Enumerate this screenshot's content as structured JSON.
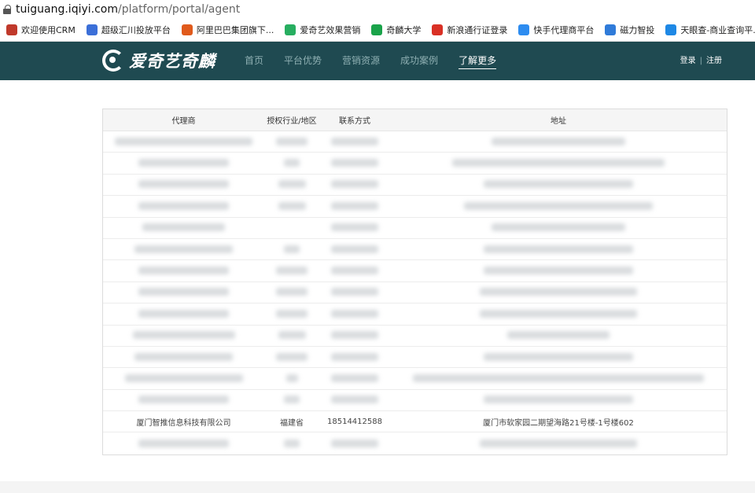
{
  "browser": {
    "url_domain": "tuiguang.iqiyi.com",
    "url_path": "/platform/portal/agent"
  },
  "bookmarks": [
    {
      "label": "欢迎使用CRM",
      "icon": "crm-icon",
      "color": "#c0392b"
    },
    {
      "label": "超级汇川投放平台",
      "icon": "uc-icon",
      "color": "#3b6fd8"
    },
    {
      "label": "阿里巴巴集团旗下...",
      "icon": "alibaba-icon",
      "color": "#e05a1c"
    },
    {
      "label": "爱奇艺效果营销",
      "icon": "iqiyi-icon",
      "color": "#27ae60"
    },
    {
      "label": "奇麟大学",
      "icon": "qilin-icon",
      "color": "#1aa34a"
    },
    {
      "label": "新浪通行证登录",
      "icon": "weibo-icon",
      "color": "#d93025"
    },
    {
      "label": "快手代理商平台",
      "icon": "kuaishou-icon",
      "color": "#2d8cf0"
    },
    {
      "label": "磁力智投",
      "icon": "cili-icon",
      "color": "#2f7bd9"
    },
    {
      "label": "天眼查-商业查询平...",
      "icon": "tianyancha-icon",
      "color": "#1e88e5"
    }
  ],
  "nav": {
    "logo_text": "爱奇艺奇麟",
    "menu": [
      "首页",
      "平台优势",
      "营销资源",
      "成功案例",
      "了解更多"
    ],
    "active_index": 4,
    "login": "登录",
    "separator": "|",
    "register": "注册"
  },
  "table": {
    "headers": [
      "代理商",
      "授权行业/地区",
      "联系方式",
      "地址"
    ],
    "visible_row": {
      "agent": "厦门智推信息科技有限公司",
      "region": "福建省",
      "phone": "18514412588",
      "address": "厦门市软家园二期望海路21号楼-1号楼602"
    }
  }
}
